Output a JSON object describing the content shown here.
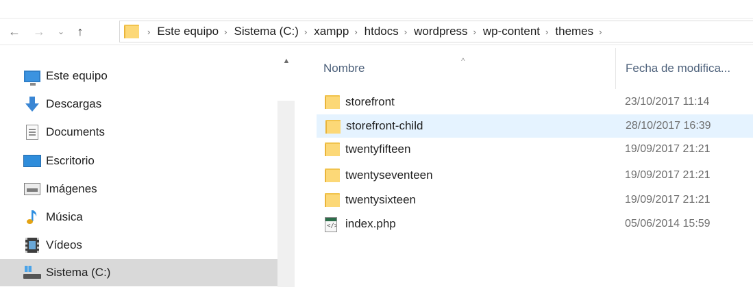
{
  "navigation": {
    "back_glyph": "←",
    "forward_glyph": "→",
    "recent_glyph": "⌄",
    "up_glyph": "↑"
  },
  "address": {
    "separator": "›",
    "crumbs": [
      "Este equipo",
      "Sistema (C:)",
      "xampp",
      "htdocs",
      "wordpress",
      "wp-content",
      "themes"
    ]
  },
  "sidebar": {
    "items": [
      {
        "label": "Este equipo",
        "icon": "computer-icon"
      },
      {
        "label": "Descargas",
        "icon": "download-icon"
      },
      {
        "label": "Documents",
        "icon": "document-icon"
      },
      {
        "label": "Escritorio",
        "icon": "desktop-icon"
      },
      {
        "label": "Imágenes",
        "icon": "pictures-icon"
      },
      {
        "label": "Música",
        "icon": "music-icon"
      },
      {
        "label": "Vídeos",
        "icon": "videos-icon"
      },
      {
        "label": "Sistema (C:)",
        "icon": "drive-icon"
      }
    ],
    "selected_index": 7
  },
  "columns": {
    "name": "Nombre",
    "date": "Fecha de modifica...",
    "sort_glyph": "^"
  },
  "files": [
    {
      "name": "storefront",
      "date": "23/10/2017 11:14",
      "type": "folder"
    },
    {
      "name": "storefront-child",
      "date": "28/10/2017 16:39",
      "type": "folder"
    },
    {
      "name": "twentyfifteen",
      "date": "19/09/2017 21:21",
      "type": "folder"
    },
    {
      "name": "twentyseventeen",
      "date": "19/09/2017 21:21",
      "type": "folder"
    },
    {
      "name": "twentysixteen",
      "date": "19/09/2017 21:21",
      "type": "folder"
    },
    {
      "name": "index.php",
      "date": "05/06/2014 15:59",
      "type": "php-file"
    }
  ],
  "selected_file_index": 1,
  "colors": {
    "folder": "#fcd877",
    "selection_row": "#e5f3ff",
    "selection_sidebar": "#d9d9d9",
    "header_text": "#4c607a"
  }
}
